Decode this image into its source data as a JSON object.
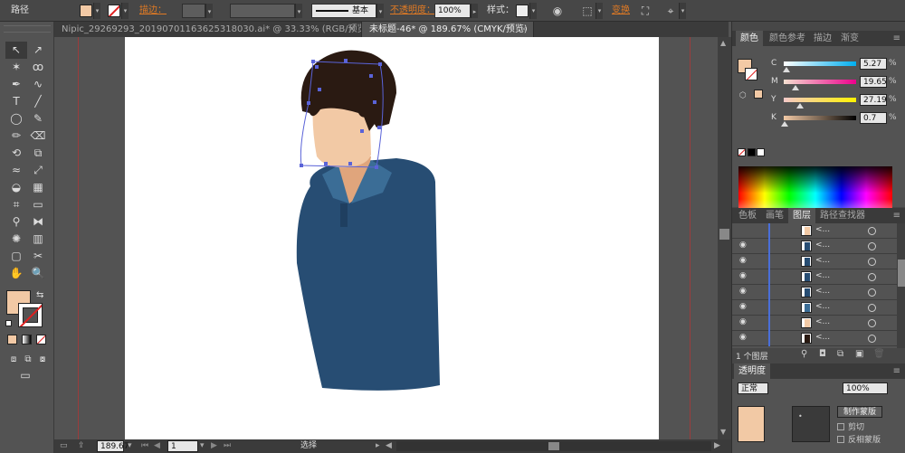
{
  "control_bar": {
    "tool_name": "路径",
    "fill_color": "#f2c9a5",
    "stroke_label": "描边：",
    "stroke_style_label": "基本",
    "opacity_label": "不透明度：",
    "opacity_value": "100%",
    "style_label": "样式：",
    "transform_label": "变换",
    "icons": [
      "recolor-icon",
      "align-icon",
      "transform-icon",
      "isolate-icon"
    ]
  },
  "doc_tabs": [
    {
      "label": "Nipic_29269293_20190701163625318030.ai* @ 33.33% (RGB/预览)",
      "close": "×"
    },
    {
      "label": "未标题-46* @ 189.67% (CMYK/预览)",
      "close": "×"
    }
  ],
  "tools": {
    "items": [
      "selection-tool",
      "direct-selection-tool",
      "magic-wand-tool",
      "lasso-tool",
      "pen-tool",
      "curvature-tool",
      "type-tool",
      "line-tool",
      "ellipse-tool",
      "paintbrush-tool",
      "pencil-tool",
      "eraser-tool",
      "rotate-tool",
      "scale-tool",
      "width-tool",
      "free-transform-tool",
      "shape-builder-tool",
      "perspective-grid-tool",
      "mesh-tool",
      "gradient-tool",
      "eyedropper-tool",
      "blend-tool",
      "symbol-sprayer-tool",
      "column-graph-tool",
      "artboard-tool",
      "slice-tool",
      "hand-tool",
      "zoom-tool"
    ],
    "glyphs": [
      "↖",
      "↗",
      "✶",
      "ꝏ",
      "✒",
      "∿",
      "T",
      "╱",
      "◯",
      "✎",
      "✏",
      "⌫",
      "⟲",
      "⧉",
      "≈",
      "⤢",
      "◒",
      "▦",
      "⌗",
      "▭",
      "⚲",
      "⧓",
      "✺",
      "▥",
      "▢",
      "✂",
      "✋",
      "🔍"
    ],
    "fill": "#f2c9a5",
    "stroke": "none"
  },
  "status_bar": {
    "zoom": "189.67",
    "artboard": "1",
    "mode": "选择"
  },
  "color_panel": {
    "tabs": [
      "颜色",
      "颜色参考",
      "描边",
      "渐变"
    ],
    "active_tab": "颜色",
    "channels": [
      {
        "label": "C",
        "value": "5.27",
        "unit": "%",
        "gradient": "linear-gradient(to right,#fff,#00aeef)"
      },
      {
        "label": "M",
        "value": "19.65",
        "unit": "%",
        "gradient": "linear-gradient(to right,#f5e0d0,#ec008c)"
      },
      {
        "label": "Y",
        "value": "27.19",
        "unit": "%",
        "gradient": "linear-gradient(to right,#f5c9c9,#fff200)"
      },
      {
        "label": "K",
        "value": "0.7",
        "unit": "%",
        "gradient": "linear-gradient(to right,#f2c9a5,#000)"
      }
    ]
  },
  "layers_panel": {
    "tabs": [
      "色板",
      "画笔",
      "图层",
      "路径查找器"
    ],
    "active_tab": "图层",
    "rows": [
      {
        "name": "<...",
        "thumb_color": "#f2c9a5"
      },
      {
        "name": "<...",
        "thumb_color": "#274d73"
      },
      {
        "name": "<...",
        "thumb_color": "#274d73"
      },
      {
        "name": "<...",
        "thumb_color": "#274d73"
      },
      {
        "name": "<...",
        "thumb_color": "#274d73"
      },
      {
        "name": "<...",
        "thumb_color": "#3b6d96"
      },
      {
        "name": "<...",
        "thumb_color": "#f2c9a5"
      },
      {
        "name": "<...",
        "thumb_color": "#2a1a12"
      }
    ],
    "footer_count": "1 个图层"
  },
  "transparency_panel": {
    "tab": "透明度",
    "mode": "正常",
    "opacity": "100%",
    "make_mask_button": "制作蒙版",
    "clip_label": "剪切",
    "invert_label": "反相蒙版"
  },
  "colors": {
    "shirt": "#274d73",
    "collar": "#3b6d96",
    "skin": "#f2c9a5",
    "neck_shadow": "#e0a57c",
    "hair": "#2a1a12",
    "selection": "#5a63d8"
  }
}
